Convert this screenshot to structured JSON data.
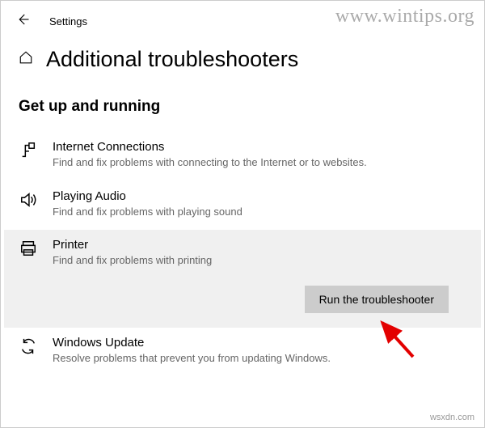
{
  "titlebar": {
    "title": "Settings"
  },
  "header": {
    "page_title": "Additional troubleshooters"
  },
  "section": {
    "heading": "Get up and running"
  },
  "items": [
    {
      "title": "Internet Connections",
      "desc": "Find and fix problems with connecting to the Internet or to websites."
    },
    {
      "title": "Playing Audio",
      "desc": "Find and fix problems with playing sound"
    },
    {
      "title": "Printer",
      "desc": "Find and fix problems with printing"
    },
    {
      "title": "Windows Update",
      "desc": "Resolve problems that prevent you from updating Windows."
    }
  ],
  "run_button": {
    "label": "Run the troubleshooter"
  },
  "watermark": "www.wintips.org",
  "source": "wsxdn.com"
}
